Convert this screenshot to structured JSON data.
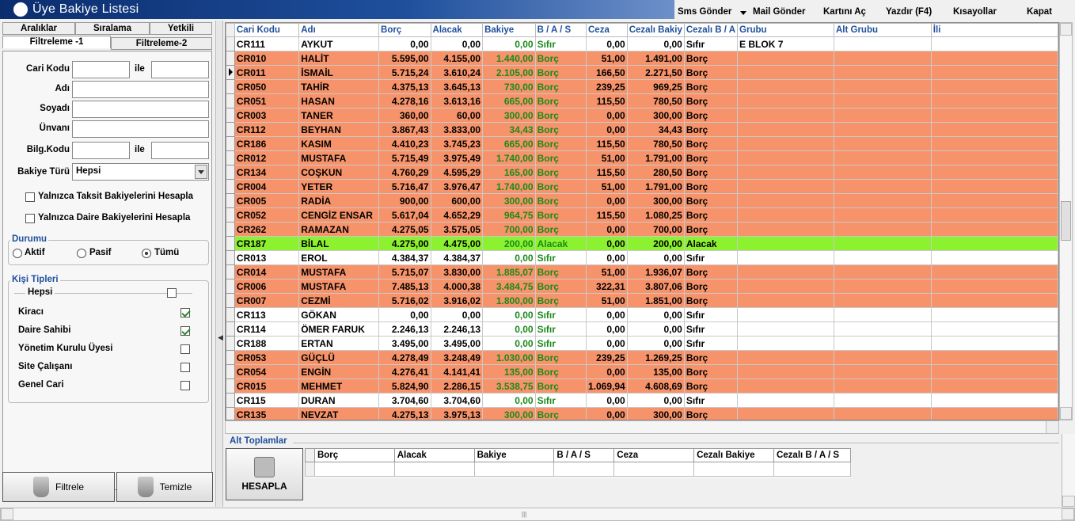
{
  "window": {
    "title": "Üye Bakiye Listesi"
  },
  "menu": [
    "Sms Gönder",
    "Mail Gönder",
    "Kartını Aç",
    "Yazdır (F4)",
    "Kısayollar",
    "Kapat"
  ],
  "tabs_row1": [
    "Aralıklar",
    "Sıralama",
    "Yetkili"
  ],
  "tabs_row2": [
    "Filtreleme -1",
    "Filtreleme-2"
  ],
  "filters": {
    "cari_kodu": "Cari Kodu",
    "ile": "ile",
    "adi": "Adı",
    "soyadi": "Soyadı",
    "unvani": "Ünvanı",
    "bilg_kodu": "Bilg.Kodu",
    "bakiye_turu": "Bakiye Türü",
    "bakiye_turu_value": "Hepsi",
    "taksit_check": "Yalnızca Taksit Bakiyelerini Hesapla",
    "daire_check": "Yalnızca Daire  Bakiyelerini Hesapla"
  },
  "durumu": {
    "title": "Durumu",
    "options": [
      "Aktif",
      "Pasif",
      "Tümü"
    ],
    "selected": "Tümü"
  },
  "kisi_tipleri": {
    "title": "Kişi Tipleri",
    "hepsi": "Hepsi",
    "items": [
      {
        "label": "Kiracı",
        "checked": true
      },
      {
        "label": "Daire Sahibi",
        "checked": true
      },
      {
        "label": "Yönetim Kurulu Üyesi",
        "checked": false
      },
      {
        "label": "Site Çalışanı",
        "checked": false
      },
      {
        "label": "Genel Cari",
        "checked": false
      }
    ]
  },
  "buttons": {
    "filtrele": "Filtrele",
    "temizle": "Temizle",
    "hesapla": "HESAPLA"
  },
  "grid": {
    "columns": [
      "Cari Kodu",
      "Adı",
      "Borç",
      "Alacak",
      "Bakiye",
      "B / A / S",
      "Ceza",
      "Cezalı Bakiy",
      "Cezalı B / A",
      "Grubu",
      "Alt Grubu",
      "İli"
    ],
    "rows": [
      {
        "kod": "CR111",
        "adi": "AYKUT",
        "borc": "0,00",
        "alacak": "0,00",
        "bakiye": "0,00",
        "bas": "Sıfır",
        "ceza": "0,00",
        "cbak": "0,00",
        "cbas": "Sıfır",
        "grubu": "E BLOK 7",
        "style": "white"
      },
      {
        "kod": "CR010",
        "adi": "HALİT",
        "borc": "5.595,00",
        "alacak": "4.155,00",
        "bakiye": "1.440,00",
        "bas": "Borç",
        "ceza": "51,00",
        "cbak": "1.491,00",
        "cbas": "Borç",
        "grubu": "",
        "style": "orange"
      },
      {
        "kod": "CR011",
        "adi": "İSMAİL",
        "borc": "5.715,24",
        "alacak": "3.610,24",
        "bakiye": "2.105,00",
        "bas": "Borç",
        "ceza": "166,50",
        "cbak": "2.271,50",
        "cbas": "Borç",
        "grubu": "",
        "style": "orange",
        "current": true
      },
      {
        "kod": "CR050",
        "adi": "TAHİR",
        "borc": "4.375,13",
        "alacak": "3.645,13",
        "bakiye": "730,00",
        "bas": "Borç",
        "ceza": "239,25",
        "cbak": "969,25",
        "cbas": "Borç",
        "grubu": "",
        "style": "orange"
      },
      {
        "kod": "CR051",
        "adi": "HASAN",
        "borc": "4.278,16",
        "alacak": "3.613,16",
        "bakiye": "665,00",
        "bas": "Borç",
        "ceza": "115,50",
        "cbak": "780,50",
        "cbas": "Borç",
        "grubu": "",
        "style": "orange"
      },
      {
        "kod": "CR003",
        "adi": "TANER",
        "borc": "360,00",
        "alacak": "60,00",
        "bakiye": "300,00",
        "bas": "Borç",
        "ceza": "0,00",
        "cbak": "300,00",
        "cbas": "Borç",
        "grubu": "",
        "style": "orange"
      },
      {
        "kod": "CR112",
        "adi": "BEYHAN",
        "borc": "3.867,43",
        "alacak": "3.833,00",
        "bakiye": "34,43",
        "bas": "Borç",
        "ceza": "0,00",
        "cbak": "34,43",
        "cbas": "Borç",
        "grubu": "",
        "style": "orange"
      },
      {
        "kod": "CR186",
        "adi": "KASIM",
        "borc": "4.410,23",
        "alacak": "3.745,23",
        "bakiye": "665,00",
        "bas": "Borç",
        "ceza": "115,50",
        "cbak": "780,50",
        "cbas": "Borç",
        "grubu": "",
        "style": "orange"
      },
      {
        "kod": "CR012",
        "adi": "MUSTAFA",
        "borc": "5.715,49",
        "alacak": "3.975,49",
        "bakiye": "1.740,00",
        "bas": "Borç",
        "ceza": "51,00",
        "cbak": "1.791,00",
        "cbas": "Borç",
        "grubu": "",
        "style": "orange"
      },
      {
        "kod": "CR134",
        "adi": "COŞKUN",
        "borc": "4.760,29",
        "alacak": "4.595,29",
        "bakiye": "165,00",
        "bas": "Borç",
        "ceza": "115,50",
        "cbak": "280,50",
        "cbas": "Borç",
        "grubu": "",
        "style": "orange"
      },
      {
        "kod": "CR004",
        "adi": "YETER",
        "borc": "5.716,47",
        "alacak": "3.976,47",
        "bakiye": "1.740,00",
        "bas": "Borç",
        "ceza": "51,00",
        "cbak": "1.791,00",
        "cbas": "Borç",
        "grubu": "",
        "style": "orange"
      },
      {
        "kod": "CR005",
        "adi": "RADİA",
        "borc": "900,00",
        "alacak": "600,00",
        "bakiye": "300,00",
        "bas": "Borç",
        "ceza": "0,00",
        "cbak": "300,00",
        "cbas": "Borç",
        "grubu": "",
        "style": "orange"
      },
      {
        "kod": "CR052",
        "adi": "CENGİZ ENSAR",
        "borc": "5.617,04",
        "alacak": "4.652,29",
        "bakiye": "964,75",
        "bas": "Borç",
        "ceza": "115,50",
        "cbak": "1.080,25",
        "cbas": "Borç",
        "grubu": "",
        "style": "orange"
      },
      {
        "kod": "CR262",
        "adi": "RAMAZAN",
        "borc": "4.275,05",
        "alacak": "3.575,05",
        "bakiye": "700,00",
        "bas": "Borç",
        "ceza": "0,00",
        "cbak": "700,00",
        "cbas": "Borç",
        "grubu": "",
        "style": "orange"
      },
      {
        "kod": "CR187",
        "adi": "BİLAL",
        "borc": "4.275,00",
        "alacak": "4.475,00",
        "bakiye": "200,00",
        "bas": "Alacak",
        "ceza": "0,00",
        "cbak": "200,00",
        "cbas": "Alacak",
        "grubu": "",
        "style": "green"
      },
      {
        "kod": "CR013",
        "adi": "EROL",
        "borc": "4.384,37",
        "alacak": "4.384,37",
        "bakiye": "0,00",
        "bas": "Sıfır",
        "ceza": "0,00",
        "cbak": "0,00",
        "cbas": "Sıfır",
        "grubu": "",
        "style": "white"
      },
      {
        "kod": "CR014",
        "adi": "MUSTAFA",
        "borc": "5.715,07",
        "alacak": "3.830,00",
        "bakiye": "1.885,07",
        "bas": "Borç",
        "ceza": "51,00",
        "cbak": "1.936,07",
        "cbas": "Borç",
        "grubu": "",
        "style": "orange"
      },
      {
        "kod": "CR006",
        "adi": "MUSTAFA",
        "borc": "7.485,13",
        "alacak": "4.000,38",
        "bakiye": "3.484,75",
        "bas": "Borç",
        "ceza": "322,31",
        "cbak": "3.807,06",
        "cbas": "Borç",
        "grubu": "",
        "style": "orange"
      },
      {
        "kod": "CR007",
        "adi": "CEZMİ",
        "borc": "5.716,02",
        "alacak": "3.916,02",
        "bakiye": "1.800,00",
        "bas": "Borç",
        "ceza": "51,00",
        "cbak": "1.851,00",
        "cbas": "Borç",
        "grubu": "",
        "style": "orange"
      },
      {
        "kod": "CR113",
        "adi": "GÖKAN",
        "borc": "0,00",
        "alacak": "0,00",
        "bakiye": "0,00",
        "bas": "Sıfır",
        "ceza": "0,00",
        "cbak": "0,00",
        "cbas": "Sıfır",
        "grubu": "",
        "style": "white"
      },
      {
        "kod": "CR114",
        "adi": "ÖMER FARUK",
        "borc": "2.246,13",
        "alacak": "2.246,13",
        "bakiye": "0,00",
        "bas": "Sıfır",
        "ceza": "0,00",
        "cbak": "0,00",
        "cbas": "Sıfır",
        "grubu": "",
        "style": "white"
      },
      {
        "kod": "CR188",
        "adi": "ERTAN",
        "borc": "3.495,00",
        "alacak": "3.495,00",
        "bakiye": "0,00",
        "bas": "Sıfır",
        "ceza": "0,00",
        "cbak": "0,00",
        "cbas": "Sıfır",
        "grubu": "",
        "style": "white"
      },
      {
        "kod": "CR053",
        "adi": "GÜÇLÜ",
        "borc": "4.278,49",
        "alacak": "3.248,49",
        "bakiye": "1.030,00",
        "bas": "Borç",
        "ceza": "239,25",
        "cbak": "1.269,25",
        "cbas": "Borç",
        "grubu": "",
        "style": "orange"
      },
      {
        "kod": "CR054",
        "adi": "ENGİN",
        "borc": "4.276,41",
        "alacak": "4.141,41",
        "bakiye": "135,00",
        "bas": "Borç",
        "ceza": "0,00",
        "cbak": "135,00",
        "cbas": "Borç",
        "grubu": "",
        "style": "orange"
      },
      {
        "kod": "CR015",
        "adi": "MEHMET",
        "borc": "5.824,90",
        "alacak": "2.286,15",
        "bakiye": "3.538,75",
        "bas": "Borç",
        "ceza": "1.069,94",
        "cbak": "4.608,69",
        "cbas": "Borç",
        "grubu": "",
        "style": "orange"
      },
      {
        "kod": "CR115",
        "adi": "DURAN",
        "borc": "3.704,60",
        "alacak": "3.704,60",
        "bakiye": "0,00",
        "bas": "Sıfır",
        "ceza": "0,00",
        "cbak": "0,00",
        "cbas": "Sıfır",
        "grubu": "",
        "style": "white"
      },
      {
        "kod": "CR135",
        "adi": "NEVZAT",
        "borc": "4.275,13",
        "alacak": "3.975,13",
        "bakiye": "300,00",
        "bas": "Borç",
        "ceza": "0,00",
        "cbak": "300,00",
        "cbas": "Borç",
        "grubu": "",
        "style": "orange"
      }
    ]
  },
  "alt_toplamlar": {
    "title": "Alt Toplamlar",
    "columns": [
      "Borç",
      "Alacak",
      "Bakiye",
      "B / A / S",
      "Ceza",
      "Cezalı Bakiye",
      "Cezalı B / A / S"
    ]
  },
  "colors": {
    "orange_row": "#f7936a",
    "green_row": "#8cf230",
    "header_text": "#1f4f9c",
    "bakiye_text": "#1a8a1a"
  }
}
